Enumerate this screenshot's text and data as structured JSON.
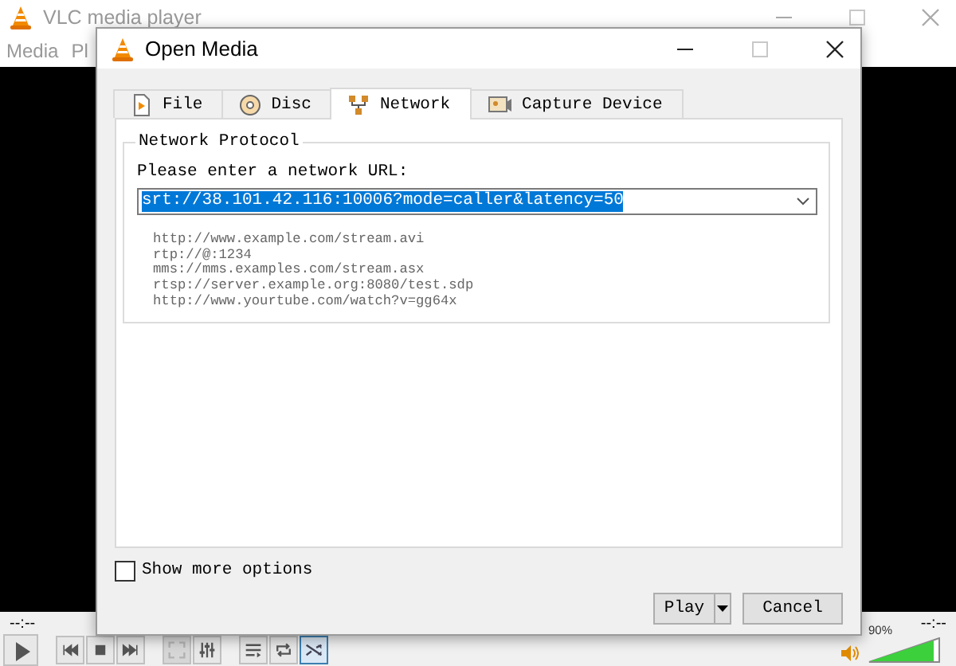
{
  "main_window": {
    "title": "VLC media player",
    "menu": [
      "Media",
      "Pl"
    ],
    "time_elapsed": "--:--",
    "time_total": "--:--",
    "controls": [
      {
        "kind": "play",
        "disabled": false,
        "selected": false
      },
      {
        "kind": "prev",
        "disabled": false,
        "selected": false
      },
      {
        "kind": "stop",
        "disabled": false,
        "selected": false
      },
      {
        "kind": "next",
        "disabled": false,
        "selected": false
      },
      {
        "kind": "fullscreen",
        "disabled": true,
        "selected": false
      },
      {
        "kind": "equalizer",
        "disabled": false,
        "selected": false
      },
      {
        "kind": "playlist",
        "disabled": false,
        "selected": false
      },
      {
        "kind": "loop",
        "disabled": false,
        "selected": false
      },
      {
        "kind": "random",
        "disabled": false,
        "selected": true
      }
    ],
    "volume": {
      "level": 0.9,
      "reading": "90%"
    }
  },
  "dialog": {
    "title": "Open Media",
    "tabs": [
      {
        "label": "File",
        "kind": "file",
        "selected": false
      },
      {
        "label": "Disc",
        "kind": "disc",
        "selected": false
      },
      {
        "label": "Network",
        "kind": "network",
        "selected": true
      },
      {
        "label": "Capture Device",
        "kind": "capture",
        "selected": false
      }
    ],
    "group_title": "Network Protocol",
    "prompt": "Please enter a network URL:",
    "url": {
      "value": "srt://38.101.42.116:10006?mode=caller&latency=50",
      "selected": true
    },
    "examples": [
      "http://www.example.com/stream.avi",
      "rtp://@:1234",
      "mms://mms.examples.com/stream.asx",
      "rtsp://server.example.org:8080/test.sdp",
      "http://www.yourtube.com/watch?v=gg64x"
    ],
    "show_more_options": {
      "label": "Show more options",
      "checked": false
    },
    "buttons": [
      {
        "label": "Play",
        "kind": "split"
      },
      {
        "label": "Cancel",
        "kind": "plain"
      }
    ]
  }
}
